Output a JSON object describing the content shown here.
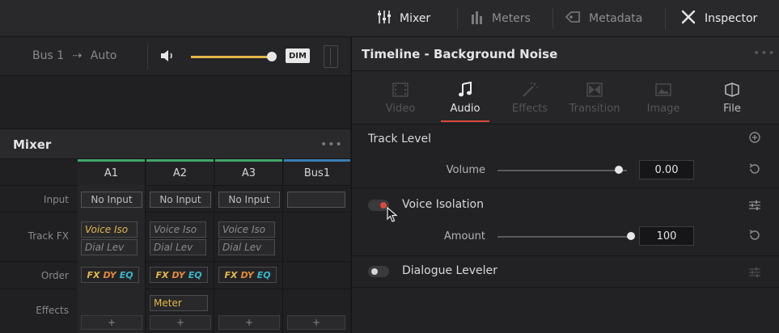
{
  "topbar": {
    "mixer_label": "Mixer",
    "meters_label": "Meters",
    "metadata_label": "Metadata",
    "inspector_label": "Inspector"
  },
  "bus_row": {
    "bus_label": "Bus 1",
    "arrow": "⇢",
    "mode_label": "Auto",
    "dim_label": "DIM",
    "volume_level": 0.85
  },
  "mixer": {
    "title": "Mixer",
    "menu_dots": "•••",
    "row_labels": {
      "input": "Input",
      "track_fx": "Track FX",
      "order": "Order",
      "effects": "Effects"
    },
    "columns": [
      {
        "name": "A1",
        "input": "No Input",
        "fx1": "Voice Iso",
        "fx2": "Dial Lev",
        "order": [
          "FX",
          "DY",
          "EQ"
        ],
        "effect": "",
        "add": "+"
      },
      {
        "name": "A2",
        "input": "No Input",
        "fx1": "Voice Iso",
        "fx2": "Dial Lev",
        "order": [
          "FX",
          "DY",
          "EQ"
        ],
        "effect": "Meter",
        "add": "+"
      },
      {
        "name": "A3",
        "input": "No Input",
        "fx1": "Voice Iso",
        "fx2": "Dial Lev",
        "order": [
          "FX",
          "DY",
          "EQ"
        ],
        "effect": "",
        "add": "+"
      },
      {
        "name": "Bus1",
        "input": "",
        "fx1": "",
        "fx2": "",
        "order": [],
        "effect": "",
        "add": "+"
      }
    ]
  },
  "inspector": {
    "title": "Timeline - Background Noise",
    "menu_dots": "•••",
    "tabs": [
      {
        "label": "Video",
        "icon": "film-icon",
        "state": "disabled"
      },
      {
        "label": "Audio",
        "icon": "music-note-icon",
        "state": "active"
      },
      {
        "label": "Effects",
        "icon": "wand-icon",
        "state": "disabled"
      },
      {
        "label": "Transition",
        "icon": "transition-icon",
        "state": "disabled"
      },
      {
        "label": "Image",
        "icon": "image-icon",
        "state": "disabled"
      },
      {
        "label": "File",
        "icon": "file-icon",
        "state": "enabled"
      }
    ],
    "track_level": {
      "title": "Track Level",
      "volume_label": "Volume",
      "volume_value": "0.00",
      "volume_fraction": 0.8
    },
    "voice_isolation": {
      "title": "Voice Isolation",
      "enabled": true,
      "amount_label": "Amount",
      "amount_value": "100",
      "amount_fraction": 1.0
    },
    "dialogue_leveler": {
      "title": "Dialogue Leveler",
      "enabled": false
    }
  },
  "colors": {
    "accent_red": "#d94a3c",
    "fx_yellow": "#e3b84a",
    "track_green": "#3fa66b",
    "bus_blue": "#3a7fb5",
    "dy_orange": "#e08a3a",
    "eq_teal": "#3ab7c9"
  }
}
